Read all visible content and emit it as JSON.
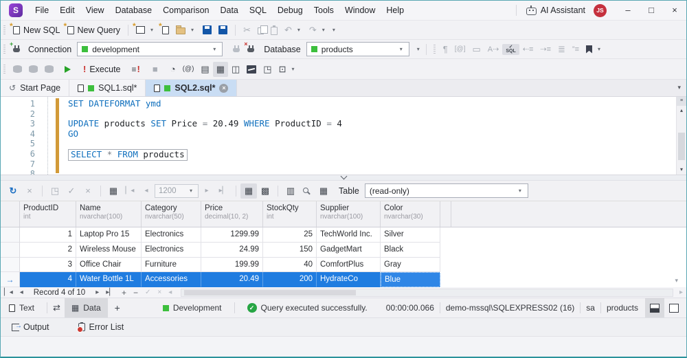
{
  "titlebar": {
    "menus": [
      "File",
      "Edit",
      "View",
      "Database",
      "Comparison",
      "Data",
      "SQL",
      "Debug",
      "Tools",
      "Window",
      "Help"
    ],
    "ai_assistant": "AI Assistant",
    "user_badge": "JS"
  },
  "toolbars": {
    "new_sql": "New SQL",
    "new_query": "New Query",
    "connection_label": "Connection",
    "connection_value": "development",
    "database_label": "Database",
    "database_value": "products",
    "execute_label": "Execute"
  },
  "tabs": {
    "start_page": "Start Page",
    "sql1": "SQL1.sql*",
    "sql2": "SQL2.sql*"
  },
  "editor": {
    "lines": [
      {
        "n": "1",
        "tokens": [
          {
            "t": "SET",
            "c": "kw"
          },
          {
            "t": " ",
            "c": "pl"
          },
          {
            "t": "DATEFORMAT",
            "c": "kw"
          },
          {
            "t": " ",
            "c": "pl"
          },
          {
            "t": "ymd",
            "c": "kw"
          }
        ]
      },
      {
        "n": "2",
        "tokens": []
      },
      {
        "n": "3",
        "tokens": [
          {
            "t": "UPDATE",
            "c": "kw"
          },
          {
            "t": " products ",
            "c": "pl"
          },
          {
            "t": "SET",
            "c": "kw"
          },
          {
            "t": " Price ",
            "c": "pl"
          },
          {
            "t": "=",
            "c": "op"
          },
          {
            "t": " 20.49 ",
            "c": "pl"
          },
          {
            "t": "WHERE",
            "c": "kw"
          },
          {
            "t": " ProductID ",
            "c": "pl"
          },
          {
            "t": "=",
            "c": "op"
          },
          {
            "t": " 4",
            "c": "pl"
          }
        ]
      },
      {
        "n": "4",
        "tokens": [
          {
            "t": "GO",
            "c": "kw"
          }
        ]
      },
      {
        "n": "5",
        "tokens": []
      },
      {
        "n": "6",
        "boxed": true,
        "tokens": [
          {
            "t": "SELECT",
            "c": "kw"
          },
          {
            "t": " ",
            "c": "pl"
          },
          {
            "t": "*",
            "c": "op"
          },
          {
            "t": " ",
            "c": "pl"
          },
          {
            "t": "FROM",
            "c": "kw"
          },
          {
            "t": " products",
            "c": "pl"
          }
        ]
      },
      {
        "n": "7",
        "tokens": []
      },
      {
        "n": "8",
        "tokens": []
      }
    ]
  },
  "results_toolbar": {
    "page_size": "1200",
    "table_label": "Table",
    "table_mode": "(read-only)"
  },
  "grid": {
    "columns": [
      {
        "name": "ProductID",
        "type": "int",
        "align": "right",
        "width": 82
      },
      {
        "name": "Name",
        "type": "nvarchar(100)",
        "align": "left",
        "width": 95
      },
      {
        "name": "Category",
        "type": "nvarchar(50)",
        "align": "left",
        "width": 87
      },
      {
        "name": "Price",
        "type": "decimal(10, 2)",
        "align": "right",
        "width": 90
      },
      {
        "name": "StockQty",
        "type": "int",
        "align": "right",
        "width": 78
      },
      {
        "name": "Supplier",
        "type": "nvarchar(100)",
        "align": "left",
        "width": 93
      },
      {
        "name": "Color",
        "type": "nvarchar(30)",
        "align": "left",
        "width": 87
      }
    ],
    "rows": [
      {
        "cells": [
          "1",
          "Laptop Pro 15",
          "Electronics",
          "1299.99",
          "25",
          "TechWorld Inc.",
          "Silver"
        ],
        "selected": false
      },
      {
        "cells": [
          "2",
          "Wireless Mouse",
          "Electronics",
          "24.99",
          "150",
          "GadgetMart",
          "Black"
        ],
        "selected": false
      },
      {
        "cells": [
          "3",
          "Office Chair",
          "Furniture",
          "199.99",
          "40",
          "ComfortPlus",
          "Gray"
        ],
        "selected": false
      },
      {
        "cells": [
          "4",
          "Water Bottle 1L",
          "Accessories",
          "20.49",
          "200",
          "HydrateCo",
          "Blue"
        ],
        "selected": true,
        "focus_cell": 6
      }
    ]
  },
  "record_navigator": {
    "label": "Record 4 of 10"
  },
  "statusbar": {
    "text_tab": "Text",
    "data_tab": "Data",
    "environment": "Development",
    "message": "Query executed successfully.",
    "duration": "00:00:00.066",
    "server": "demo-mssql\\SQLEXPRESS02 (16)",
    "user": "sa",
    "database": "products"
  },
  "bottom_panel": {
    "output_tab": "Output",
    "error_list_tab": "Error List"
  },
  "colors": {
    "accent_blue": "#1f7ce0",
    "success_green": "#27a544",
    "env_green": "#3dbf3d",
    "brand_purple": "#7b2fbe",
    "change_bar": "#d29a38"
  },
  "icons": {
    "logo_letter": "S",
    "minimize": "–",
    "maximize": "□",
    "close": "×",
    "dropdown": "▾",
    "star": "*",
    "cut": "✂",
    "undo": "↶",
    "redo": "↷",
    "format_pilcrow": "¶",
    "at_brackets": "[@]",
    "rename_box": "▭",
    "navigate_az": "A⇢",
    "sql_label": "SQL",
    "check": "✓",
    "outdent": "⇠≡",
    "indent": "⇢≡",
    "indent_block": "≣",
    "comment_lines": "”≡",
    "menu_lines": "≡",
    "bang": "!",
    "stop": "■",
    "history": "◔",
    "at_paren": "(@)",
    "plan_doc": "▤",
    "grid_view": "▦",
    "layout_view": "◫",
    "image_export": "◳",
    "window_split": "⊡",
    "refresh": "↻",
    "close_x": "×",
    "nav_first": "▏◂",
    "nav_prev": "◂",
    "nav_next": "▸",
    "nav_last": "▸▏",
    "cards_view": "▩",
    "columns_view": "▥",
    "rec_add": "+",
    "rec_delete": "−",
    "rec_accept": "✓",
    "rec_cancel": "×",
    "swap": "⇄",
    "plus": "+",
    "start_page_icon": "↺",
    "row_arrow": "→",
    "scroll_up": "▴",
    "scroll_down": "▾",
    "scroll_left": "◂",
    "scroll_right": "▸",
    "splitter_grip": "≡"
  }
}
